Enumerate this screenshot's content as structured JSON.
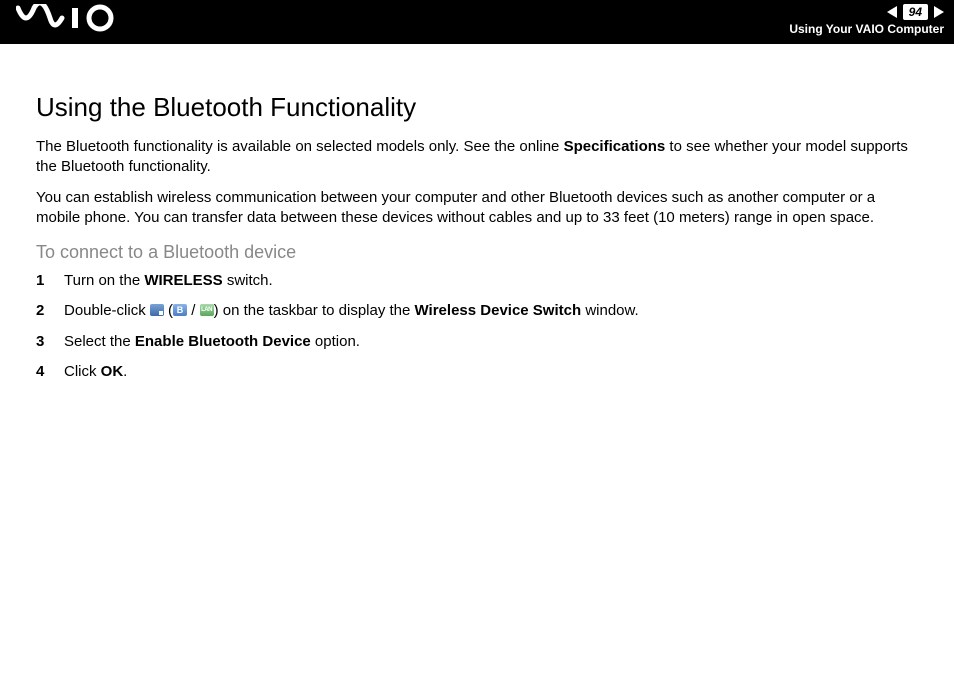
{
  "header": {
    "page_number": "94",
    "section": "Using Your VAIO Computer"
  },
  "title": "Using the Bluetooth Functionality",
  "para1": {
    "pre": "The Bluetooth functionality is available on selected models only. See the online ",
    "bold": "Specifications",
    "post": " to see whether your model supports the Bluetooth functionality."
  },
  "para2": "You can establish wireless communication between your computer and other Bluetooth devices such as another computer or a mobile phone. You can transfer data between these devices without cables and up to 33 feet (10 meters) range in open space.",
  "subheading": "To connect to a Bluetooth device",
  "steps": {
    "s1": {
      "pre": "Turn on the ",
      "b1": "WIRELESS",
      "post": " switch."
    },
    "s2": {
      "pre": "Double-click ",
      "open_paren": " (",
      "slash": " / ",
      "close_paren": ") ",
      "mid": "on the taskbar to display the ",
      "b1": "Wireless Device Switch",
      "post": " window."
    },
    "s3": {
      "pre": "Select the ",
      "b1": "Enable Bluetooth Device",
      "post": " option."
    },
    "s4": {
      "pre": "Click ",
      "b1": "OK",
      "post": "."
    }
  }
}
